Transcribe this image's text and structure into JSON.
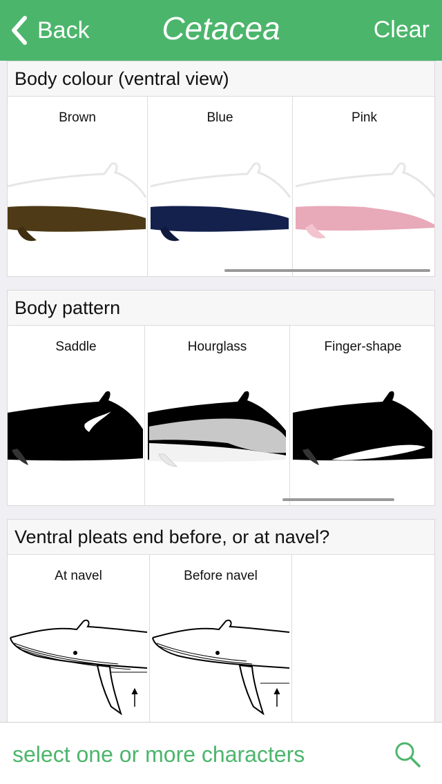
{
  "nav": {
    "back_label": "Back",
    "title": "Cetacea",
    "clear_label": "Clear"
  },
  "sections": [
    {
      "title": "Body colour (ventral view)",
      "options": [
        {
          "label": "Brown",
          "color": "#4e3a17"
        },
        {
          "label": "Blue",
          "color": "#14214d"
        },
        {
          "label": "Pink",
          "color": "#e8a9b9"
        }
      ]
    },
    {
      "title": "Body pattern",
      "options": [
        {
          "label": "Saddle",
          "illustration": "whale-saddle-pattern"
        },
        {
          "label": "Hourglass",
          "illustration": "whale-hourglass-pattern"
        },
        {
          "label": "Finger-shape",
          "illustration": "whale-finger-shape-pattern"
        }
      ]
    },
    {
      "title": "Ventral pleats end before, or at navel?",
      "options": [
        {
          "label": "At navel",
          "illustration": "whale-pleats-at-navel"
        },
        {
          "label": "Before navel",
          "illustration": "whale-pleats-before-navel"
        }
      ]
    }
  ],
  "search": {
    "placeholder": "select one or more characters",
    "icon": "search-icon"
  },
  "colors": {
    "accent": "#4cb56c",
    "background": "#efeff4"
  }
}
